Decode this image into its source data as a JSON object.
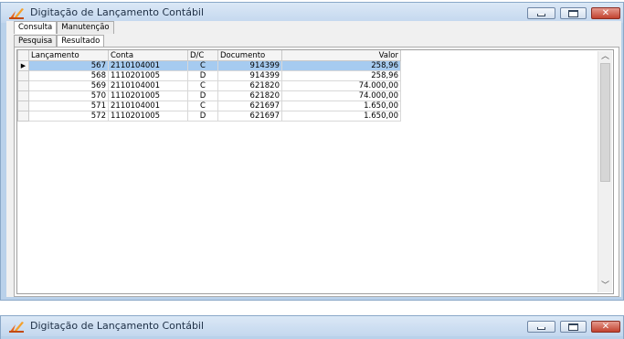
{
  "window": {
    "title": "Digitação de Lançamento Contábil",
    "second_title": "Digitação de Lançamento Contábil"
  },
  "tabs": [
    {
      "label": "Consulta",
      "active": true
    },
    {
      "label": "Manutenção",
      "active": false
    }
  ],
  "subtabs": [
    {
      "label": "Pesquisa",
      "active": false
    },
    {
      "label": "Resultado",
      "active": true
    }
  ],
  "grid": {
    "columns": [
      "Lançamento",
      "Conta",
      "D/C",
      "Documento",
      "Valor"
    ],
    "selected_row_index": 0,
    "current_row_marker": "▶",
    "rows": [
      {
        "lancamento": "567",
        "conta": "2110104001",
        "dc": "C",
        "documento": "914399",
        "valor": "258,96"
      },
      {
        "lancamento": "568",
        "conta": "1110201005",
        "dc": "D",
        "documento": "914399",
        "valor": "258,96"
      },
      {
        "lancamento": "569",
        "conta": "2110104001",
        "dc": "C",
        "documento": "621820",
        "valor": "74.000,00"
      },
      {
        "lancamento": "570",
        "conta": "1110201005",
        "dc": "D",
        "documento": "621820",
        "valor": "74.000,00"
      },
      {
        "lancamento": "571",
        "conta": "2110104001",
        "dc": "C",
        "documento": "621697",
        "valor": "1.650,00"
      },
      {
        "lancamento": "572",
        "conta": "1110201005",
        "dc": "D",
        "documento": "621697",
        "valor": "1.650,00"
      }
    ]
  },
  "icons": {
    "app": "app-logo-icon",
    "minimize": "minimize-icon",
    "maximize": "maximize-icon",
    "close": "close-icon",
    "scroll_up": "chevron-up-icon",
    "scroll_down": "chevron-down-icon"
  },
  "colors": {
    "selection": "#a6cbf0",
    "titlebar": "#c3d7ee",
    "close_button": "#c2422f"
  }
}
